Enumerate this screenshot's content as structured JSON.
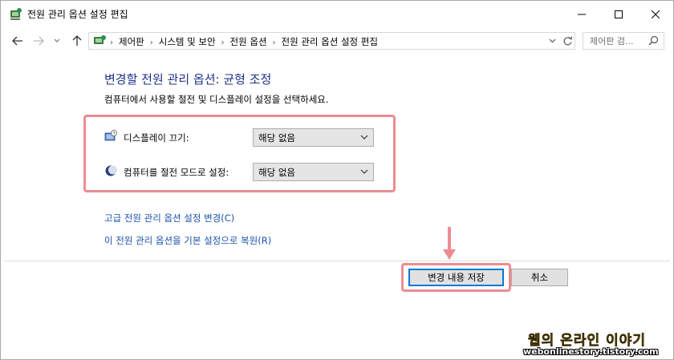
{
  "window": {
    "title": "전원 관리 옵션 설정 편집"
  },
  "address": {
    "crumbs": [
      "제어판",
      "시스템 및 보안",
      "전원 옵션",
      "전원 관리 옵션 설정 편집"
    ],
    "search_placeholder": "제어판 검..."
  },
  "content": {
    "heading": "변경할 전원 관리 옵션: 균형 조정",
    "subtext": "컴퓨터에서 사용할 절전 및 디스플레이 설정을 선택하세요.",
    "settings": [
      {
        "label": "디스플레이 끄기:",
        "value": "해당 없음",
        "icon": "monitor-clock-icon"
      },
      {
        "label": "컴퓨터를 절전 모드로 설정:",
        "value": "해당 없음",
        "icon": "moon-icon"
      }
    ],
    "links": [
      "고급 전원 관리 옵션 설정 변경(C)",
      "이 전원 관리 옵션을 기본 설정으로 복원(R)"
    ]
  },
  "buttons": {
    "save": "변경 내용 저장",
    "cancel": "취소"
  },
  "watermark": {
    "title": "웹의 온라인 이야기",
    "url": "webonlinestory.tistory.com"
  },
  "colors": {
    "heading": "#1e3287",
    "link": "#1a52a8",
    "highlight": "#ec8c92",
    "accent": "#0078d7"
  }
}
